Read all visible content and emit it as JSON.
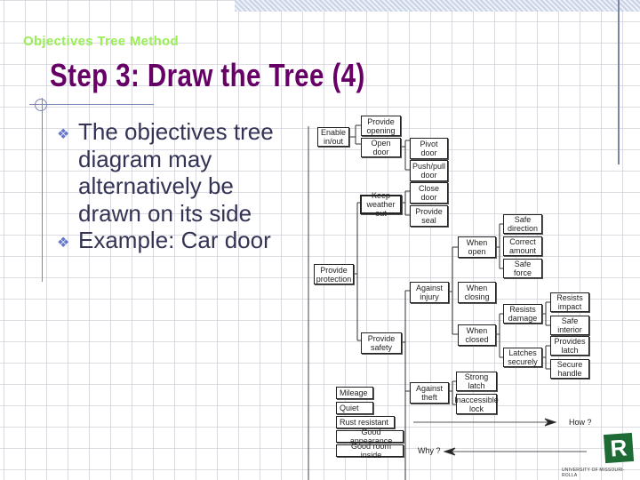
{
  "header": {
    "subtitle": "Objectives Tree Method",
    "title": "Step 3: Draw the Tree (4)"
  },
  "bullets": [
    {
      "icon": "diamond-cluster-bullet",
      "text": "The objectives tree diagram may alternatively be drawn on its side"
    },
    {
      "icon": "diamond-cluster-bullet",
      "text": "Example: Car door"
    }
  ],
  "diagram": {
    "nodes": {
      "enable": "Enable\nin/out",
      "provide_opening": "Provide\nopening",
      "open_door": "Open\ndoor",
      "pivot_door": "Pivot\ndoor",
      "push_pull_door": "Push/pull\ndoor",
      "keep_weather_out": "Keep\nweather out",
      "close_door": "Close\ndoor",
      "provide_seal": "Provide\nseal",
      "provide_protection": "Provide\nprotection",
      "provide_safety": "Provide\nsafety",
      "against_injury": "Against\ninjury",
      "when_open": "When\nopen",
      "safe_direction": "Safe\ndirection",
      "correct_amount": "Correct\namount",
      "safe_force": "Safe\nforce",
      "when_closing": "When\nclosing",
      "when_closed": "When\nclosed",
      "resists_damage": "Resists\ndamage",
      "resists_impact": "Resists\nimpact",
      "safe_interior": "Safe\ninterior",
      "latches_securely": "Latches\nsecurely",
      "provides_latch": "Provides\nlatch",
      "secure_handle": "Secure\nhandle",
      "against_theft": "Against\ntheft",
      "strong_latch": "Strong\nlatch",
      "inaccessible_lock": "Inaccessible\nlock"
    },
    "other_objectives": [
      "Mileage",
      "Quiet",
      "Rust resistant",
      "Good appearance",
      "Good room inside"
    ],
    "how_label": "How ?",
    "why_label": "Why ?"
  },
  "logo": {
    "mark": "R",
    "caption": "UNIVERSITY OF MISSOURI-ROLLA",
    "color": "#1e6b35"
  }
}
